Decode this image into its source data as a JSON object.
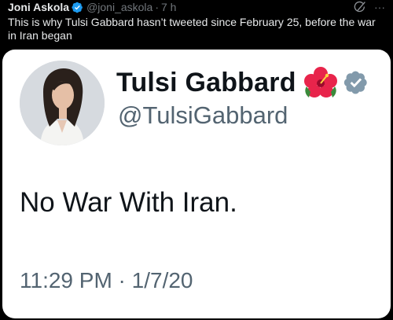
{
  "post": {
    "author_name": "Joni Askola",
    "author_handle": "@joni_askola",
    "separator": "·",
    "timestamp": "7 h",
    "text": "This is why Tulsi Gabbard hasn’t tweeted since February 25, before the war in Iran began",
    "more_icon": "···"
  },
  "quoted": {
    "name": "Tulsi Gabbard",
    "handle": "@TulsiGabbard",
    "text": "No War With Iran.",
    "timestamp": "11:29 PM · 1/7/20"
  },
  "icons": {
    "verified": "verified-badge-icon",
    "grok": "grok-icon",
    "more": "more-icon",
    "hibiscus": "hibiscus-emoji-icon",
    "quoted_verified": "gray-verified-badge-icon"
  },
  "colors": {
    "background": "#000000",
    "text_primary": "#e7e9ea",
    "text_secondary": "#71767b",
    "verified_blue": "#1d9bf0",
    "card_background": "#ffffff",
    "card_text": "#0f1419",
    "card_secondary": "#536471",
    "gray_verified": "#829aab"
  }
}
